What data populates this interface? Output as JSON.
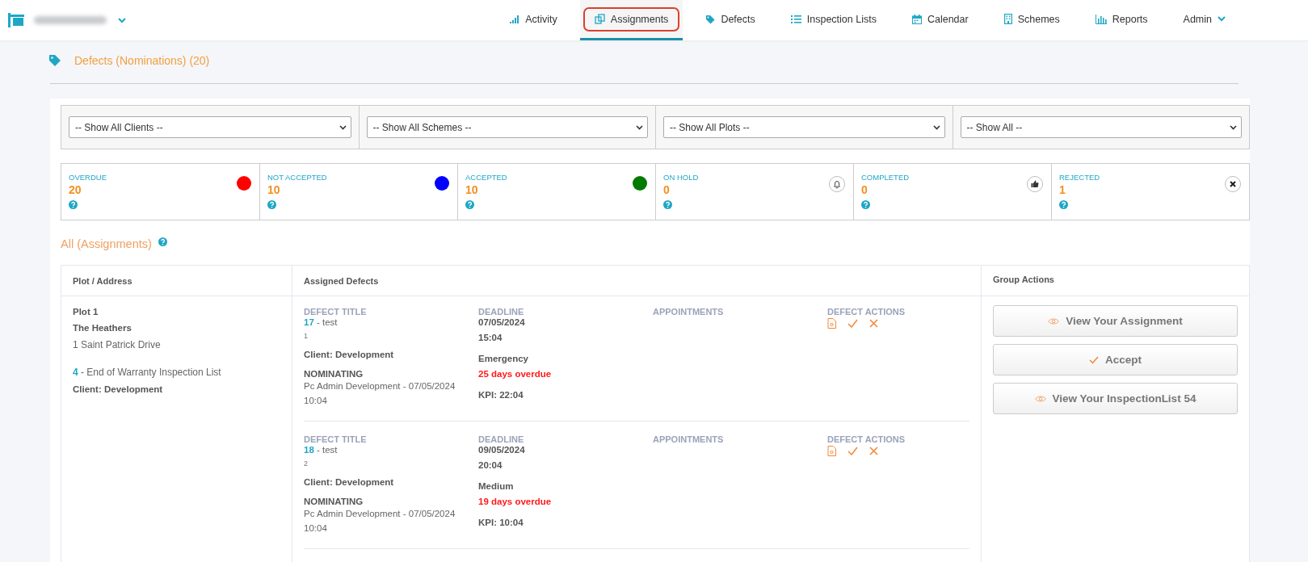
{
  "nav": {
    "items": [
      {
        "label": "Activity",
        "kind": "signal",
        "selected": false,
        "highlighted": false
      },
      {
        "label": "Assignments",
        "kind": "copy",
        "selected": true,
        "highlighted": true
      },
      {
        "label": "Defects",
        "kind": "tag",
        "selected": false,
        "highlighted": false
      },
      {
        "label": "Inspection Lists",
        "kind": "list",
        "selected": false,
        "highlighted": false
      },
      {
        "label": "Calendar",
        "kind": "calendar",
        "selected": false,
        "highlighted": false
      },
      {
        "label": "Schemes",
        "kind": "building",
        "selected": false,
        "highlighted": false
      },
      {
        "label": "Reports",
        "kind": "chart",
        "selected": false,
        "highlighted": false
      },
      {
        "label": "Admin",
        "kind": "caret",
        "selected": false,
        "highlighted": false
      }
    ]
  },
  "page_title": "Defects (Nominations) (20)",
  "filters": [
    {
      "value": "-- Show All Clients --"
    },
    {
      "value": "-- Show All Schemes --"
    },
    {
      "value": "-- Show All Plots --"
    },
    {
      "value": "-- Show All --"
    }
  ],
  "stats": [
    {
      "label": "OVERDUE",
      "count": "20",
      "kind": "dot",
      "color": "#ff0000"
    },
    {
      "label": "NOT ACCEPTED",
      "count": "10",
      "kind": "dot",
      "color": "#0000ff"
    },
    {
      "label": "ACCEPTED",
      "count": "10",
      "kind": "dot",
      "color": "#007a00"
    },
    {
      "label": "ON HOLD",
      "count": "0",
      "kind": "bell"
    },
    {
      "label": "COMPLETED",
      "count": "0",
      "kind": "thumb"
    },
    {
      "label": "REJECTED",
      "count": "1",
      "kind": "cross"
    }
  ],
  "section_title": "All (Assignments)",
  "table": {
    "columns": [
      "Plot / Address",
      "Assigned Defects",
      "Group Actions"
    ],
    "rows": [
      {
        "plot": "Plot 1",
        "scheme": "The Heathers",
        "address": "1 Saint Patrick Drive",
        "inspection_id": "4",
        "inspection_name": "- End of Warranty Inspection List",
        "client": "Client: Development",
        "defects": [
          {
            "title_label": "DEFECT TITLE",
            "id": "17",
            "title": "- test",
            "number": "1",
            "client": "Client: Development",
            "status": "NOMINATING",
            "by": "Pc Admin Development - 07/05/2024 10:04",
            "deadline_label": "DEADLINE",
            "date": "07/05/2024",
            "time": "15:04",
            "priority": "Emergency",
            "overdue": "25 days overdue",
            "kpi": "KPI: 22:04",
            "appointments_label": "APPOINTMENTS",
            "actions_label": "DEFECT ACTIONS"
          },
          {
            "title_label": "DEFECT TITLE",
            "id": "18",
            "title": "- test",
            "number": "2",
            "client": "Client: Development",
            "status": "NOMINATING",
            "by": "Pc Admin Development - 07/05/2024 10:04",
            "deadline_label": "DEADLINE",
            "date": "09/05/2024",
            "time": "20:04",
            "priority": "Medium",
            "overdue": "19 days overdue",
            "kpi": "KPI: 10:04",
            "appointments_label": "APPOINTMENTS",
            "actions_label": "DEFECT ACTIONS"
          }
        ],
        "actions": [
          {
            "label": "View Your Assignment",
            "kind": "eye"
          },
          {
            "label": "Accept",
            "kind": "check"
          },
          {
            "label": "View Your InspectionList 54",
            "kind": "eye"
          }
        ]
      }
    ]
  }
}
